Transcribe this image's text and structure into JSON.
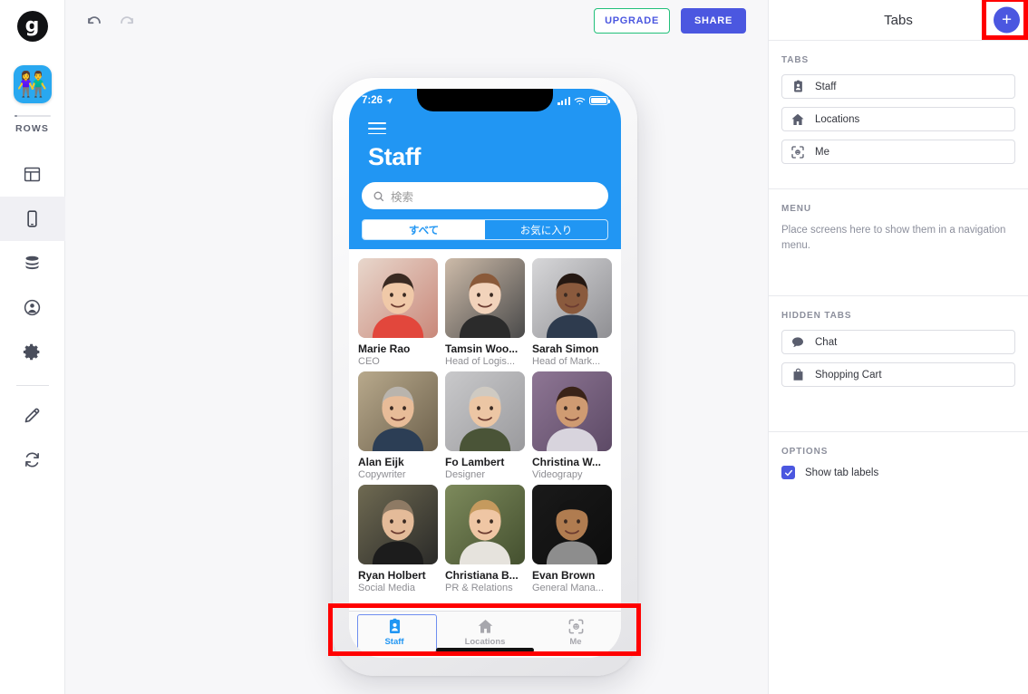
{
  "rail": {
    "logo_glyph": "g",
    "app_icon_glyph": "👫",
    "rows_label": "ROWS",
    "items": [
      {
        "name": "layout-icon",
        "label": "Layout",
        "active": false
      },
      {
        "name": "device-icon",
        "label": "Device",
        "active": true
      },
      {
        "name": "database-icon",
        "label": "Data",
        "active": false
      },
      {
        "name": "account-icon",
        "label": "Users",
        "active": false
      },
      {
        "name": "gear-icon",
        "label": "Settings",
        "active": false
      },
      {
        "name": "pencil-icon",
        "label": "Edit",
        "active": false
      },
      {
        "name": "refresh-icon",
        "label": "Refresh",
        "active": false
      }
    ]
  },
  "toolbar": {
    "undo_label": "Undo",
    "redo_label": "Redo",
    "upgrade_label": "UPGRADE",
    "share_label": "SHARE",
    "upgrade_border_color": "#22c07a",
    "upgrade_text_color": "#4b57e0",
    "share_bg_color": "#4b57e0"
  },
  "phone": {
    "accent_color": "#2196f3",
    "status": {
      "time": "7:26",
      "location_arrow": "➤"
    },
    "app": {
      "title": "Staff",
      "search_placeholder": "検索",
      "segments": [
        {
          "label": "すべて",
          "selected": true
        },
        {
          "label": "お気に入り",
          "selected": false
        }
      ],
      "people": [
        {
          "name": "Marie Rao",
          "role": "CEO",
          "c1": "#e8d7cc",
          "c2": "#c9887a",
          "shirt": "#e2473c",
          "skin": "#f0c9a8",
          "hair": "#3a2a22"
        },
        {
          "name": "Tamsin Woo...",
          "role": "Head of Logis...",
          "c1": "#cdbba9",
          "c2": "#4a4a4a",
          "shirt": "#2b2b2b",
          "skin": "#f2d3bb",
          "hair": "#8a5a3a"
        },
        {
          "name": "Sarah Simon",
          "role": "Head of Mark...",
          "c1": "#d7d7d9",
          "c2": "#8f8f93",
          "shirt": "#2e3b4e",
          "skin": "#8a5a3d",
          "hair": "#241812"
        },
        {
          "name": "Alan Eijk",
          "role": "Copywriter",
          "c1": "#b8a98c",
          "c2": "#6d614c",
          "shirt": "#2c3e55",
          "skin": "#e8bc98",
          "hair": "#b9b4ad"
        },
        {
          "name": "Fo Lambert",
          "role": "Designer",
          "c1": "#c9c9cb",
          "c2": "#9a9a9d",
          "shirt": "#4a5437",
          "skin": "#ecc6a4",
          "hair": "#cfcac2"
        },
        {
          "name": "Christina W...",
          "role": "Videograpy",
          "c1": "#8e7694",
          "c2": "#5d4a66",
          "shirt": "#d8d4dd",
          "skin": "#cf9b72",
          "hair": "#3a2318"
        },
        {
          "name": "Ryan Holbert",
          "role": "Social Media",
          "c1": "#6f6a52",
          "c2": "#2a2a28",
          "shirt": "#1c1c1c",
          "skin": "#e4bb99",
          "hair": "#8e7a64"
        },
        {
          "name": "Christiana B...",
          "role": "PR & Relations",
          "c1": "#7d8a5c",
          "c2": "#44502f",
          "shirt": "#e6e3dd",
          "skin": "#efc6a4",
          "hair": "#c59a5e"
        },
        {
          "name": "Evan Brown",
          "role": "General Mana...",
          "c1": "#1a1a1a",
          "c2": "#0d0d0d",
          "shirt": "#8d8d8d",
          "skin": "#b07c50",
          "hair": "#141414"
        }
      ],
      "tabs": [
        {
          "label": "Staff",
          "icon": "badge-icon",
          "selected": true
        },
        {
          "label": "Locations",
          "icon": "home-icon",
          "selected": false
        },
        {
          "label": "Me",
          "icon": "face-id-icon",
          "selected": false
        }
      ]
    }
  },
  "panel": {
    "title": "Tabs",
    "add_button_label": "+",
    "tabs_section": {
      "label": "TABS",
      "items": [
        {
          "label": "Staff",
          "icon": "badge-icon"
        },
        {
          "label": "Locations",
          "icon": "home-icon"
        },
        {
          "label": "Me",
          "icon": "face-id-icon"
        }
      ]
    },
    "menu_section": {
      "label": "MENU",
      "hint": "Place screens here to show them in a navigation menu."
    },
    "hidden_section": {
      "label": "HIDDEN TABS",
      "items": [
        {
          "label": "Chat",
          "icon": "chat-bubble-icon"
        },
        {
          "label": "Shopping Cart",
          "icon": "shopping-bag-icon"
        }
      ]
    },
    "options_section": {
      "label": "OPTIONS",
      "show_tab_labels": {
        "label": "Show tab labels",
        "checked": true
      }
    }
  },
  "annotations": {
    "color": "#ff0000",
    "boxes": [
      {
        "name": "tab-bar-highlight",
        "target": "phone-tab-bar"
      },
      {
        "name": "add-tab-highlight",
        "target": "panel-add-button"
      }
    ]
  }
}
